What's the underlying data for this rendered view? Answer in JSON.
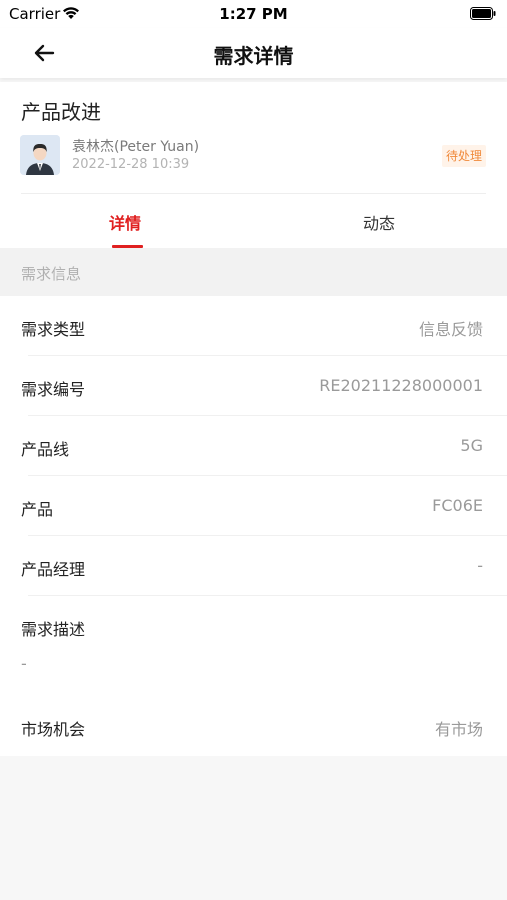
{
  "status_bar": {
    "carrier": "Carrier",
    "time": "1:27 PM"
  },
  "nav": {
    "title": "需求详情"
  },
  "header": {
    "title": "产品改进",
    "user_name": "袁林杰(Peter Yuan)",
    "created_time": "2022-12-28 10:39",
    "status": "待处理"
  },
  "tabs": [
    {
      "label": "详情",
      "active": true
    },
    {
      "label": "动态",
      "active": false
    }
  ],
  "section": {
    "title": "需求信息"
  },
  "fields": {
    "type": {
      "label": "需求类型",
      "value": "信息反馈"
    },
    "number": {
      "label": "需求编号",
      "value": "RE20211228000001"
    },
    "product_line": {
      "label": "产品线",
      "value": "5G"
    },
    "product": {
      "label": "产品",
      "value": "FC06E"
    },
    "manager": {
      "label": "产品经理",
      "value": "-"
    },
    "description": {
      "label": "需求描述",
      "value": "-"
    },
    "market": {
      "label": "市场机会",
      "value": "有市场"
    }
  },
  "colors": {
    "accent": "#e02020",
    "badge_text": "#f08a3c",
    "badge_bg": "#fff3e9"
  }
}
